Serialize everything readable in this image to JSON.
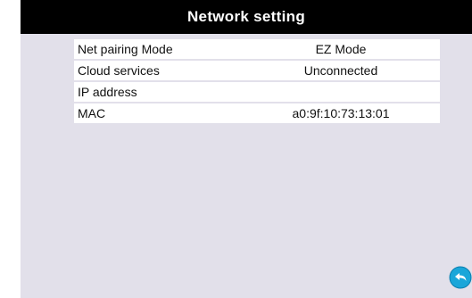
{
  "header": {
    "title": "Network setting"
  },
  "rows": [
    {
      "label": "Net pairing Mode",
      "value": "EZ Mode"
    },
    {
      "label": "Cloud services",
      "value": "Unconnected"
    },
    {
      "label": "IP address",
      "value": ""
    },
    {
      "label": "MAC",
      "value": "a0:9f:10:73:13:01"
    }
  ],
  "back_button": {
    "icon": "back-arrow-icon",
    "color": "#1aa6d9"
  }
}
